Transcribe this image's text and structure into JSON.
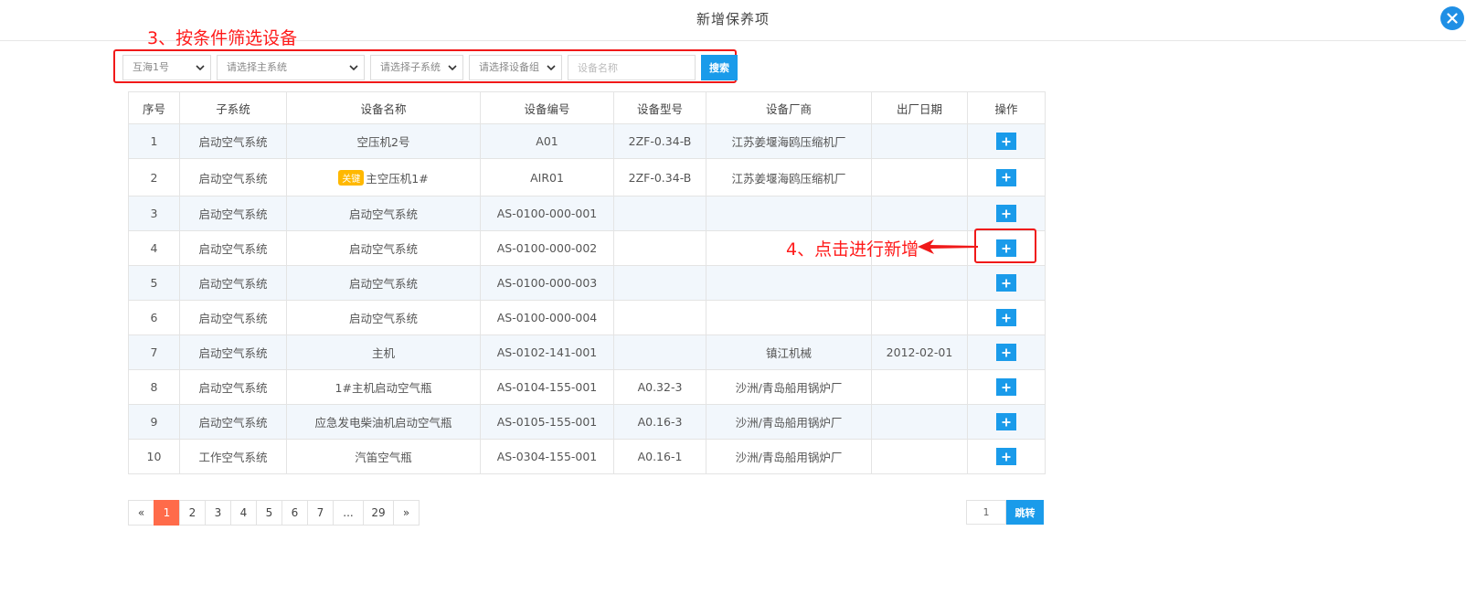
{
  "dialog": {
    "title": "新增保养项"
  },
  "annotations": {
    "step3": "3、按条件筛选设备",
    "step4": "4、点击进行新增"
  },
  "filters": {
    "ship": "互海1号",
    "main_system": "请选择主系统",
    "sub_system": "请选择子系统",
    "device_group": "请选择设备组",
    "device_name_placeholder": "设备名称",
    "search_label": "搜索"
  },
  "table": {
    "headers": [
      "序号",
      "子系统",
      "设备名称",
      "设备编号",
      "设备型号",
      "设备厂商",
      "出厂日期",
      "操作"
    ],
    "rows": [
      {
        "no": "1",
        "sub": "启动空气系统",
        "badge": "",
        "name": "空压机2号",
        "code": "A01",
        "model": "2ZF-0.34-B",
        "maker": "江苏姜堰海鸥压缩机厂",
        "date": ""
      },
      {
        "no": "2",
        "sub": "启动空气系统",
        "badge": "关键",
        "name": "主空压机1#",
        "code": "AIR01",
        "model": "2ZF-0.34-B",
        "maker": "江苏姜堰海鸥压缩机厂",
        "date": ""
      },
      {
        "no": "3",
        "sub": "启动空气系统",
        "badge": "",
        "name": "启动空气系统",
        "code": "AS-0100-000-001",
        "model": "",
        "maker": "",
        "date": ""
      },
      {
        "no": "4",
        "sub": "启动空气系统",
        "badge": "",
        "name": "启动空气系统",
        "code": "AS-0100-000-002",
        "model": "",
        "maker": "",
        "date": ""
      },
      {
        "no": "5",
        "sub": "启动空气系统",
        "badge": "",
        "name": "启动空气系统",
        "code": "AS-0100-000-003",
        "model": "",
        "maker": "",
        "date": ""
      },
      {
        "no": "6",
        "sub": "启动空气系统",
        "badge": "",
        "name": "启动空气系统",
        "code": "AS-0100-000-004",
        "model": "",
        "maker": "",
        "date": ""
      },
      {
        "no": "7",
        "sub": "启动空气系统",
        "badge": "",
        "name": "主机",
        "code": "AS-0102-141-001",
        "model": "",
        "maker": "镇江机械",
        "date": "2012-02-01"
      },
      {
        "no": "8",
        "sub": "启动空气系统",
        "badge": "",
        "name": "1#主机启动空气瓶",
        "code": "AS-0104-155-001",
        "model": "A0.32-3",
        "maker": "沙洲/青岛船用锅炉厂",
        "date": ""
      },
      {
        "no": "9",
        "sub": "启动空气系统",
        "badge": "",
        "name": "应急发电柴油机启动空气瓶",
        "code": "AS-0105-155-001",
        "model": "A0.16-3",
        "maker": "沙洲/青岛船用锅炉厂",
        "date": ""
      },
      {
        "no": "10",
        "sub": "工作空气系统",
        "badge": "",
        "name": "汽笛空气瓶",
        "code": "AS-0304-155-001",
        "model": "A0.16-1",
        "maker": "沙洲/青岛船用锅炉厂",
        "date": ""
      }
    ]
  },
  "pagination": {
    "prev": "«",
    "pages": [
      "1",
      "2",
      "3",
      "4",
      "5",
      "6",
      "7",
      "...",
      "29"
    ],
    "current": "1",
    "next": "»",
    "jump_value": "1",
    "jump_label": "跳转"
  },
  "colors": {
    "accent": "#1a9bea",
    "annotation": "#f01919",
    "active_page": "#ff6b4a",
    "badge": "#ffb800"
  }
}
